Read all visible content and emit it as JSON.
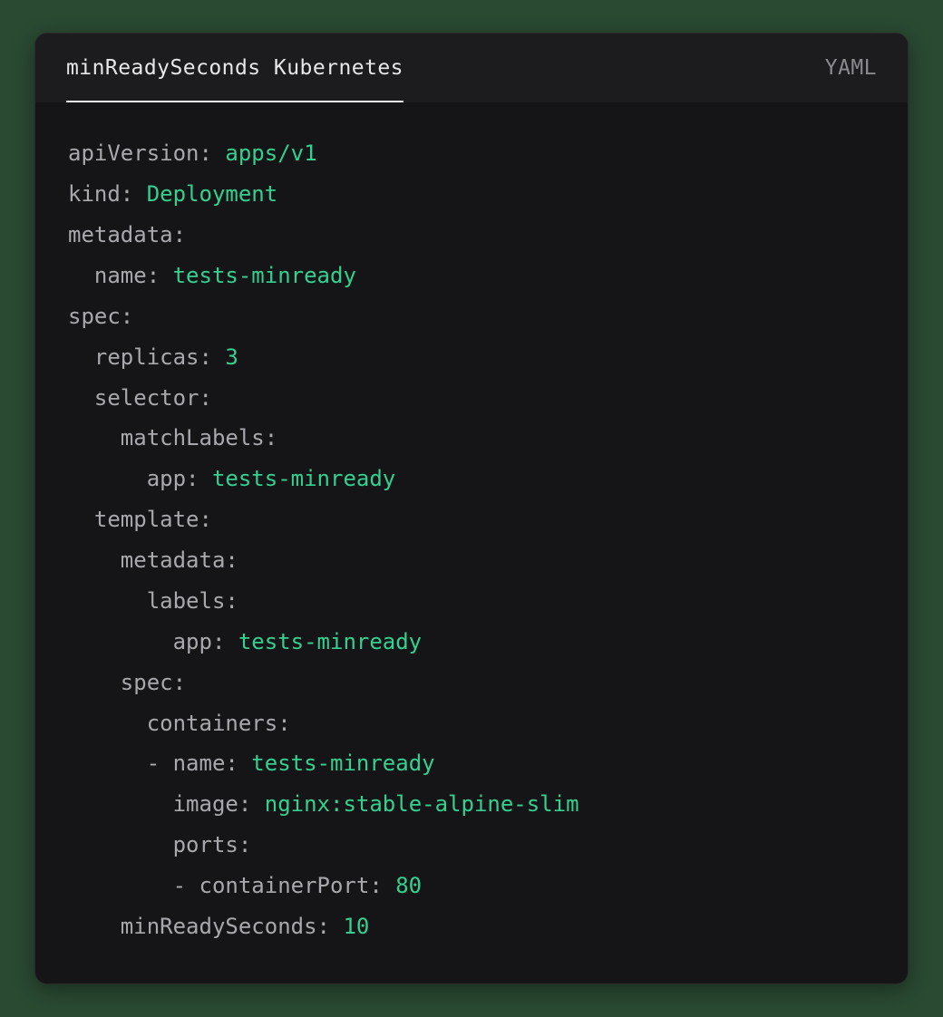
{
  "header": {
    "title": "minReadySeconds Kubernetes",
    "language": "YAML"
  },
  "code": {
    "tokens": [
      {
        "t": "apiVersion:",
        "c": "k"
      },
      {
        "t": " ",
        "c": "k"
      },
      {
        "t": "apps/v1",
        "c": "s"
      },
      {
        "t": "\n",
        "c": "k"
      },
      {
        "t": "kind:",
        "c": "k"
      },
      {
        "t": " ",
        "c": "k"
      },
      {
        "t": "Deployment",
        "c": "s"
      },
      {
        "t": "\n",
        "c": "k"
      },
      {
        "t": "metadata:",
        "c": "k"
      },
      {
        "t": "\n",
        "c": "k"
      },
      {
        "t": "  name:",
        "c": "k"
      },
      {
        "t": " ",
        "c": "k"
      },
      {
        "t": "tests-minready",
        "c": "s"
      },
      {
        "t": "\n",
        "c": "k"
      },
      {
        "t": "spec:",
        "c": "k"
      },
      {
        "t": "\n",
        "c": "k"
      },
      {
        "t": "  replicas:",
        "c": "k"
      },
      {
        "t": " ",
        "c": "k"
      },
      {
        "t": "3",
        "c": "s"
      },
      {
        "t": "\n",
        "c": "k"
      },
      {
        "t": "  selector:",
        "c": "k"
      },
      {
        "t": "\n",
        "c": "k"
      },
      {
        "t": "    matchLabels:",
        "c": "k"
      },
      {
        "t": "\n",
        "c": "k"
      },
      {
        "t": "      app:",
        "c": "k"
      },
      {
        "t": " ",
        "c": "k"
      },
      {
        "t": "tests-minready",
        "c": "s"
      },
      {
        "t": "\n",
        "c": "k"
      },
      {
        "t": "  template:",
        "c": "k"
      },
      {
        "t": "\n",
        "c": "k"
      },
      {
        "t": "    metadata:",
        "c": "k"
      },
      {
        "t": "\n",
        "c": "k"
      },
      {
        "t": "      labels:",
        "c": "k"
      },
      {
        "t": "\n",
        "c": "k"
      },
      {
        "t": "        app:",
        "c": "k"
      },
      {
        "t": " ",
        "c": "k"
      },
      {
        "t": "tests-minready",
        "c": "s"
      },
      {
        "t": "\n",
        "c": "k"
      },
      {
        "t": "    spec:",
        "c": "k"
      },
      {
        "t": "\n",
        "c": "k"
      },
      {
        "t": "      containers:",
        "c": "k"
      },
      {
        "t": "\n",
        "c": "k"
      },
      {
        "t": "      - name:",
        "c": "k"
      },
      {
        "t": " ",
        "c": "k"
      },
      {
        "t": "tests-minready",
        "c": "s"
      },
      {
        "t": "\n",
        "c": "k"
      },
      {
        "t": "        image:",
        "c": "k"
      },
      {
        "t": " ",
        "c": "k"
      },
      {
        "t": "nginx:stable-alpine-slim",
        "c": "s"
      },
      {
        "t": "\n",
        "c": "k"
      },
      {
        "t": "        ports:",
        "c": "k"
      },
      {
        "t": "\n",
        "c": "k"
      },
      {
        "t": "        - containerPort:",
        "c": "k"
      },
      {
        "t": " ",
        "c": "k"
      },
      {
        "t": "80",
        "c": "s"
      },
      {
        "t": "\n",
        "c": "k"
      },
      {
        "t": "    minReadySeconds:",
        "c": "k"
      },
      {
        "t": " ",
        "c": "k"
      },
      {
        "t": "10",
        "c": "s"
      }
    ]
  }
}
